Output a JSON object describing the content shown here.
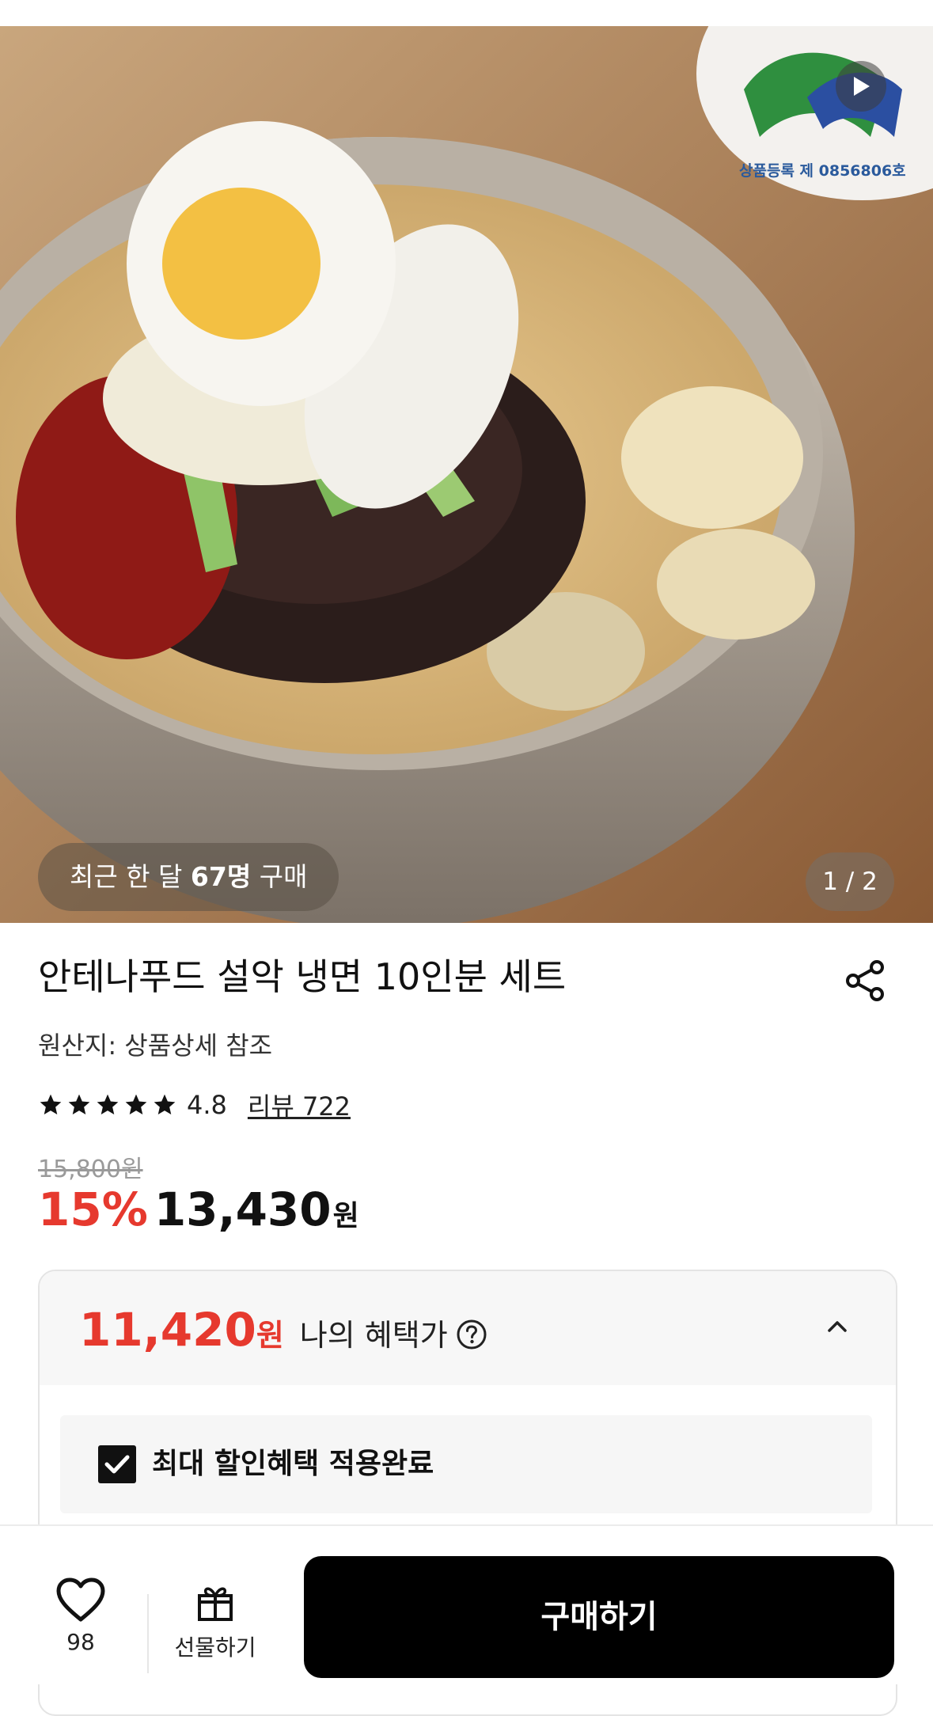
{
  "hero": {
    "recent_prefix": "최근 한 달",
    "recent_count": "67명",
    "recent_suffix": "구매",
    "image_counter": "1 / 2",
    "cert_text": "상품등록 제 0856806호",
    "play_icon": "play-icon"
  },
  "product": {
    "title": "안테나푸드 설악 냉면 10인분 세트",
    "origin": "원산지: 상품상세 참조",
    "rating": "4.8",
    "stars": 5,
    "review_link": "리뷰 722",
    "original_price": "15,800원",
    "discount": "15%",
    "sale_price": "13,430",
    "currency": "원"
  },
  "benefit": {
    "price": "11,420",
    "currency": "원",
    "label": "나의 혜택가",
    "max_label": "최대 할인혜택 적용완료"
  },
  "bottom": {
    "like_count": "98",
    "gift_label": "선물하기",
    "buy_label": "구매하기"
  },
  "colors": {
    "accent_red": "#e6392e",
    "buy_button": "#000000"
  }
}
